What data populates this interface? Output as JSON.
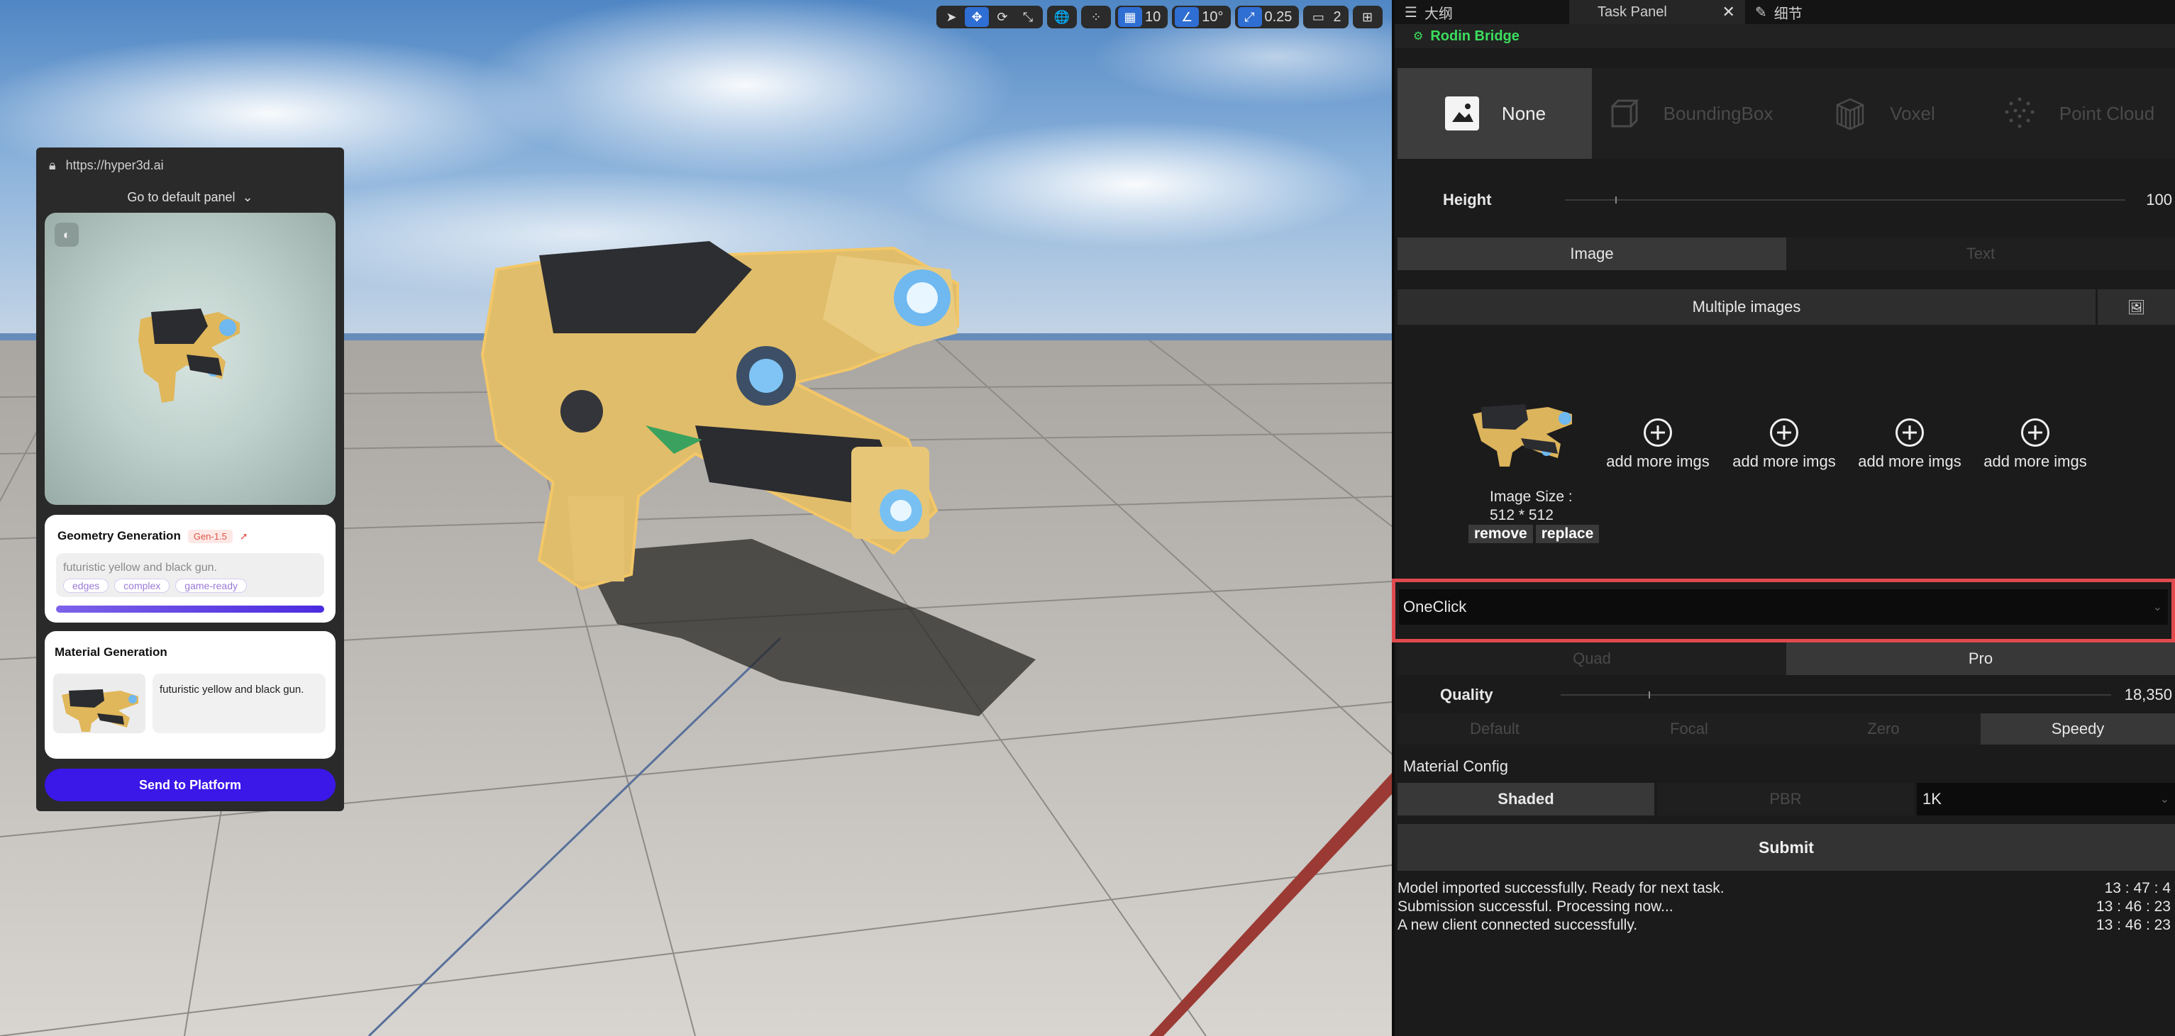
{
  "viewport": {
    "toolbar": {
      "grid_snap": "10",
      "rotate_snap": "10°",
      "scale_snap": "0.25",
      "camera_speed": "2"
    }
  },
  "web_panel": {
    "url": "https://hyper3d.ai",
    "goto_label": "Go to default panel",
    "geometry": {
      "title": "Geometry Generation",
      "badge": "Gen-1.5",
      "prompt": "futuristic yellow and black gun.",
      "tags": [
        "edges",
        "complex",
        "game-ready"
      ],
      "progress": 1.0
    },
    "material": {
      "title": "Material Generation",
      "prompt": "futuristic yellow and black gun."
    },
    "send_label": "Send to Platform"
  },
  "right_panel": {
    "tabs": {
      "outline": "大纲",
      "task_panel": "Task Panel",
      "details": "细节"
    },
    "plugin_title": "Rodin Bridge",
    "modes": [
      "None",
      "BoundingBox",
      "Voxel",
      "Point Cloud"
    ],
    "active_mode": "None",
    "height": {
      "label": "Height",
      "value": "100",
      "fraction": 0.09
    },
    "input_tabs": {
      "image": "Image",
      "text": "Text",
      "active": "Image"
    },
    "multi_images_label": "Multiple images",
    "image_info": {
      "size_label": "Image Size :",
      "size_value": "512 * 512",
      "remove": "remove",
      "replace": "replace"
    },
    "add_more_label": "add more imgs",
    "pipeline": "OneClick",
    "tier": {
      "quad": "Quad",
      "pro": "Pro",
      "active": "Pro"
    },
    "quality": {
      "label": "Quality",
      "value": "18,350",
      "fraction": 0.16
    },
    "modes2": [
      "Default",
      "Focal",
      "Zero",
      "Speedy"
    ],
    "active_mode2": "Speedy",
    "material_config": {
      "label": "Material Config",
      "shaded": "Shaded",
      "pbr": "PBR",
      "resolution": "1K"
    },
    "submit_label": "Submit",
    "log": [
      {
        "msg": "Model imported successfully. Ready for next task.",
        "time": "13 : 47 : 4"
      },
      {
        "msg": "Submission successful. Processing now...",
        "time": "13 : 46 : 23"
      },
      {
        "msg": "A new client connected successfully.",
        "time": "13 : 46 : 23"
      }
    ]
  },
  "colors": {
    "accent_green": "#3bde5e",
    "highlight_red": "#e04a4e",
    "send_purple": "#3b17e8",
    "toolbar_blue": "#2f6ed2"
  }
}
